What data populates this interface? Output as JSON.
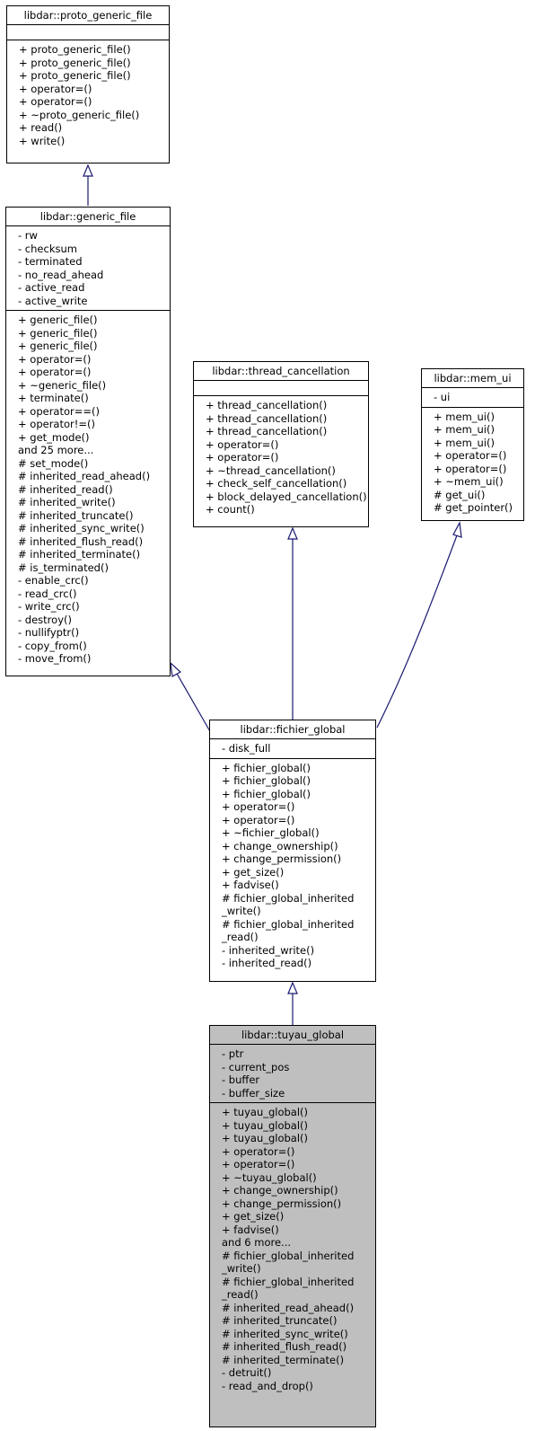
{
  "diagram": {
    "edge_color": "#191970",
    "focus_fill": "#bfbfbf",
    "classes": {
      "proto_generic_file": {
        "name": "libdar::proto_generic_file",
        "attributes": [],
        "methods": [
          "+ proto_generic_file()",
          "+ proto_generic_file()",
          "+ proto_generic_file()",
          "+ operator=()",
          "+ operator=()",
          "+ ~proto_generic_file()",
          "+ read()",
          "+ write()"
        ]
      },
      "generic_file": {
        "name": "libdar::generic_file",
        "attributes": [
          "- rw",
          "- checksum",
          "- terminated",
          "- no_read_ahead",
          "- active_read",
          "- active_write"
        ],
        "methods": [
          "+ generic_file()",
          "+ generic_file()",
          "+ generic_file()",
          "+ operator=()",
          "+ operator=()",
          "+ ~generic_file()",
          "+ terminate()",
          "+ operator==()",
          "+ operator!=()",
          "+ get_mode()",
          "and 25 more...",
          "# set_mode()",
          "# inherited_read_ahead()",
          "# inherited_read()",
          "# inherited_write()",
          "# inherited_truncate()",
          "# inherited_sync_write()",
          "# inherited_flush_read()",
          "# inherited_terminate()",
          "# is_terminated()",
          "- enable_crc()",
          "- read_crc()",
          "- write_crc()",
          "- destroy()",
          "- nullifyptr()",
          "- copy_from()",
          "- move_from()"
        ]
      },
      "thread_cancellation": {
        "name": "libdar::thread_cancellation",
        "attributes": [],
        "methods": [
          "+ thread_cancellation()",
          "+ thread_cancellation()",
          "+ thread_cancellation()",
          "+ operator=()",
          "+ operator=()",
          "+ ~thread_cancellation()",
          "+ check_self_cancellation()",
          "+ block_delayed_cancellation()",
          "+ count()"
        ]
      },
      "mem_ui": {
        "name": "libdar::mem_ui",
        "attributes": [
          "- ui"
        ],
        "methods": [
          "+ mem_ui()",
          "+ mem_ui()",
          "+ mem_ui()",
          "+ operator=()",
          "+ operator=()",
          "+ ~mem_ui()",
          "# get_ui()",
          "# get_pointer()"
        ]
      },
      "fichier_global": {
        "name": "libdar::fichier_global",
        "attributes": [
          "- disk_full"
        ],
        "methods": [
          "+ fichier_global()",
          "+ fichier_global()",
          "+ fichier_global()",
          "+ operator=()",
          "+ operator=()",
          "+ ~fichier_global()",
          "+ change_ownership()",
          "+ change_permission()",
          "+ get_size()",
          "+ fadvise()",
          "# fichier_global_inherited\n_write()",
          "# fichier_global_inherited\n_read()",
          "- inherited_write()",
          "- inherited_read()"
        ]
      },
      "tuyau_global": {
        "name": "libdar::tuyau_global",
        "attributes": [
          "- ptr",
          "- current_pos",
          "- buffer",
          "- buffer_size"
        ],
        "methods": [
          "+ tuyau_global()",
          "+ tuyau_global()",
          "+ tuyau_global()",
          "+ operator=()",
          "+ operator=()",
          "+ ~tuyau_global()",
          "+ change_ownership()",
          "+ change_permission()",
          "+ get_size()",
          "+ fadvise()",
          "and 6 more...",
          "# fichier_global_inherited\n_write()",
          "# fichier_global_inherited\n_read()",
          "# inherited_read_ahead()",
          "# inherited_truncate()",
          "# inherited_sync_write()",
          "# inherited_flush_read()",
          "# inherited_terminate()",
          "- detruit()",
          "- read_and_drop()"
        ]
      }
    },
    "edges": [
      {
        "from": "generic_file",
        "to": "proto_generic_file",
        "type": "inheritance"
      },
      {
        "from": "fichier_global",
        "to": "generic_file",
        "type": "inheritance"
      },
      {
        "from": "fichier_global",
        "to": "thread_cancellation",
        "type": "inheritance"
      },
      {
        "from": "fichier_global",
        "to": "mem_ui",
        "type": "inheritance"
      },
      {
        "from": "tuyau_global",
        "to": "fichier_global",
        "type": "inheritance"
      }
    ]
  }
}
